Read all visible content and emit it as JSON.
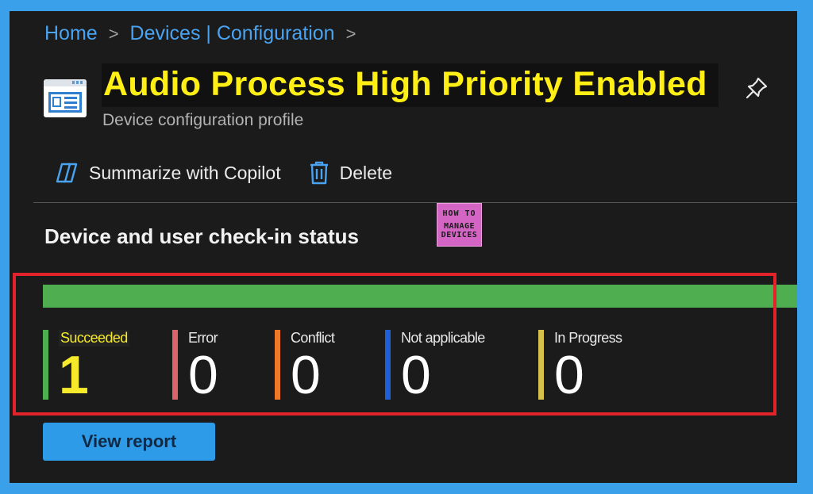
{
  "breadcrumb": {
    "items": [
      "Home",
      "Devices | Configuration"
    ],
    "separator": ">"
  },
  "profile": {
    "title": "Audio Process High Priority Enabled",
    "subtitle": "Device configuration profile"
  },
  "toolbar": {
    "copilot_label": "Summarize with Copilot",
    "delete_label": "Delete"
  },
  "logo": {
    "line1": "HOW TO",
    "line2": "MANAGE",
    "line3": "DEVICES"
  },
  "section": {
    "title": "Device and user check-in status"
  },
  "progress": {
    "succeeded_fraction": 1.0,
    "color": "#4fae4f"
  },
  "stats": [
    {
      "label": "Succeeded",
      "value": "1",
      "color": "#4fae4f"
    },
    {
      "label": "Error",
      "value": "0",
      "color": "#d9646a"
    },
    {
      "label": "Conflict",
      "value": "0",
      "color": "#ec7a2a"
    },
    {
      "label": "Not applicable",
      "value": "0",
      "color": "#1f5fd6"
    },
    {
      "label": "In Progress",
      "value": "0",
      "color": "#d6c24a"
    }
  ],
  "actions": {
    "view_report_label": "View report"
  },
  "colors": {
    "accent": "#3aa0ea",
    "title_highlight": "#ffef14",
    "annotation_border": "#e3232c"
  }
}
